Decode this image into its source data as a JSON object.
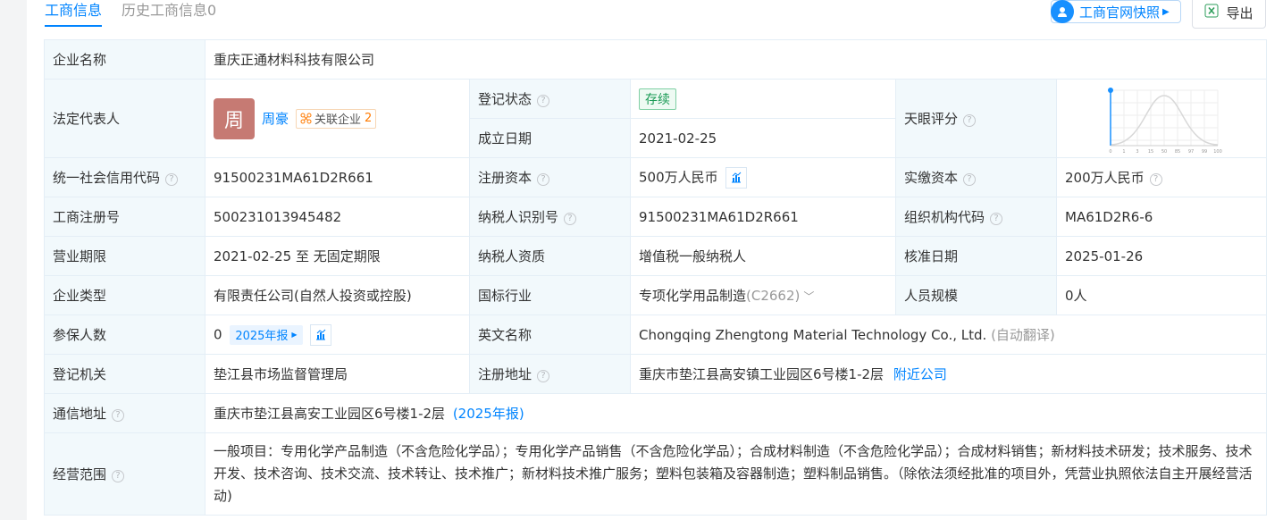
{
  "tabs": [
    {
      "label": "工商信息",
      "active": true
    },
    {
      "label": "历史工商信息0",
      "active": false
    }
  ],
  "toolbar": {
    "snapshot_label": "工商官网快照",
    "export_label": "导出"
  },
  "company": {
    "name_label": "企业名称",
    "name": "重庆正通材料科技有限公司",
    "legal_rep_label": "法定代表人",
    "legal_rep_avatar": "周",
    "legal_rep_name": "周豪",
    "related_label": "关联企业",
    "related_count": "2",
    "reg_status_label": "登记状态",
    "reg_status": "存续",
    "founded_label": "成立日期",
    "founded": "2021-02-25",
    "score_label": "天眼评分",
    "score_chart_ticks": [
      "0",
      "1",
      "3",
      "15",
      "50",
      "85",
      "97",
      "99",
      "100"
    ],
    "credit_code_label": "统一社会信用代码",
    "credit_code": "91500231MA61D2R661",
    "reg_capital_label": "注册资本",
    "reg_capital": "500万人民币",
    "paid_capital_label": "实缴资本",
    "paid_capital": "200万人民币",
    "reg_no_label": "工商注册号",
    "reg_no": "500231013945482",
    "taxpayer_id_label": "纳税人识别号",
    "taxpayer_id": "91500231MA61D2R661",
    "org_code_label": "组织机构代码",
    "org_code": "MA61D2R6-6",
    "term_label": "营业期限",
    "term": "2021-02-25 至 无固定期限",
    "taxpayer_qual_label": "纳税人资质",
    "taxpayer_qual": "增值税一般纳税人",
    "approved_label": "核准日期",
    "approved": "2025-01-26",
    "type_label": "企业类型",
    "type": "有限责任公司(自然人投资或控股)",
    "industry_label": "国标行业",
    "industry": "专项化学用品制造",
    "industry_code": "(C2662)",
    "staff_size_label": "人员规模",
    "staff_size": "0人",
    "insured_label": "参保人数",
    "insured": "0",
    "insured_report": "2025年报",
    "english_label": "英文名称",
    "english": "Chongqing Zhengtong Material Technology Co., Ltd.",
    "english_note": "(自动翻译)",
    "authority_label": "登记机关",
    "authority": "垫江县市场监督管理局",
    "reg_address_label": "注册地址",
    "reg_address": "重庆市垫江县高安镇工业园区6号楼1-2层",
    "nearby_label": "附近公司",
    "mail_address_label": "通信地址",
    "mail_address": "重庆市垫江县高安工业园区6号楼1-2层",
    "mail_address_note": "(2025年报)",
    "scope_label": "经营范围",
    "scope": "一般项目：专用化学产品制造（不含危险化学品）；专用化学产品销售（不含危险化学品）；合成材料制造（不含危险化学品）；合成材料销售；新材料技术研发；技术服务、技术开发、技术咨询、技术交流、技术转让、技术推广；新材料技术推广服务；塑料包装箱及容器制造；塑料制品销售。（除依法须经批准的项目外，凭营业执照依法自主开展经营活动)"
  },
  "colors": {
    "accent": "#0084ff",
    "label_bg": "#f2f9fc",
    "status_green": "#1a9a55",
    "avatar_bg": "#c67a73"
  }
}
